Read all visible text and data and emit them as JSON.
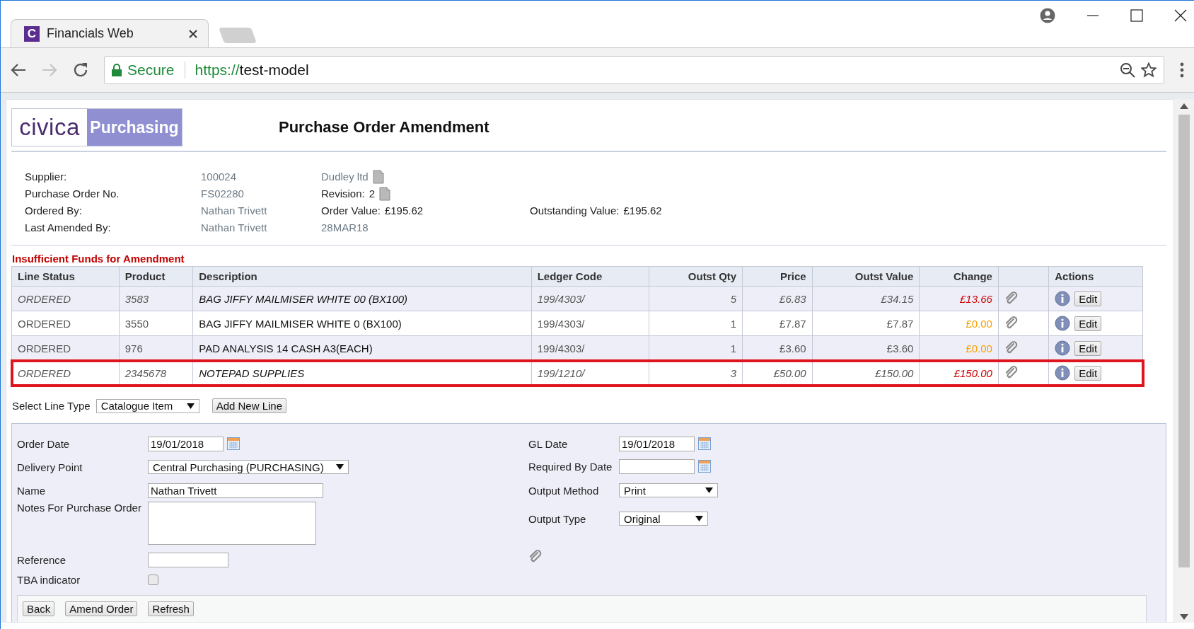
{
  "browser": {
    "tab_title": "Financials Web",
    "favicon_letter": "C",
    "secure_label": "Secure",
    "url_scheme": "https://",
    "url_host": "test-model"
  },
  "logo": {
    "brand": "civica",
    "product": "Purchasing"
  },
  "title": "Purchase Order Amendment",
  "summary": {
    "supplier_label": "Supplier:",
    "supplier_code": "100024",
    "supplier_name": "Dudley ltd",
    "po_label": "Purchase Order No.",
    "po_number": "FS02280",
    "revision_label": "Revision:",
    "revision": "2",
    "ordered_by_label": "Ordered By:",
    "ordered_by": "Nathan Trivett",
    "order_value_label": "Order Value:",
    "order_value": "£195.62",
    "outstanding_label": "Outstanding Value:",
    "outstanding_value": "£195.62",
    "last_amended_label": "Last Amended By:",
    "last_amended_by": "Nathan Trivett",
    "last_amended_date": "28MAR18"
  },
  "warning": "Insufficient Funds for Amendment",
  "table": {
    "columns": [
      "Line Status",
      "Product",
      "Description",
      "Ledger Code",
      "Outst Qty",
      "Price",
      "Outst Value",
      "Change",
      "Actions"
    ],
    "rows": [
      {
        "status": "ORDERED",
        "product": "3583",
        "description": "BAG JIFFY MAILMISER WHITE 00 (BX100)",
        "ledger_code": "199/4303/",
        "outst_qty": "5",
        "price": "£6.83",
        "outst_value": "£34.15",
        "change": "£13.66",
        "color": "#cc0000",
        "amended": true,
        "selected": false,
        "action": "Edit"
      },
      {
        "status": "ORDERED",
        "product": "3550",
        "description": "BAG JIFFY MAILMISER WHITE 0 (BX100)",
        "ledger_code": "199/4303/",
        "outst_qty": "1",
        "price": "£7.87",
        "outst_value": "£7.87",
        "change": "£0.00",
        "color": "#f5a000",
        "amended": false,
        "selected": false,
        "action": "Edit"
      },
      {
        "status": "ORDERED",
        "product": "976",
        "description": "PAD ANALYSIS 14 CASH A3(EACH)",
        "ledger_code": "199/4303/",
        "outst_qty": "1",
        "price": "£3.60",
        "outst_value": "£3.60",
        "change": "£0.00",
        "color": "#f5a000",
        "amended": false,
        "selected": false,
        "action": "Edit"
      },
      {
        "status": "ORDERED",
        "product": "2345678",
        "description": "NOTEPAD SUPPLIES",
        "ledger_code": "199/1210/",
        "outst_qty": "3",
        "price": "£50.00",
        "outst_value": "£150.00",
        "change": "£150.00",
        "color": "#cc0000",
        "amended": true,
        "selected": true,
        "action": "Edit"
      }
    ]
  },
  "line_type": {
    "label": "Select Line Type",
    "value": "Catalogue Item",
    "add_button": "Add New Line"
  },
  "form": {
    "left": [
      {
        "kind": "date",
        "label": "Order Date",
        "value": "19/01/2018"
      },
      {
        "kind": "select",
        "label": "Delivery Point",
        "value": "Central Purchasing (PURCHASING)"
      },
      {
        "kind": "text",
        "label": "Name",
        "value": "Nathan Trivett"
      },
      {
        "kind": "textarea",
        "label": "Notes For Purchase Order"
      },
      {
        "kind": "text",
        "label": "Reference"
      },
      {
        "kind": "checkbox",
        "label": "TBA indicator",
        "checked": false
      }
    ],
    "right": [
      {
        "kind": "date",
        "label": "GL Date",
        "value": "19/01/2018"
      },
      {
        "kind": "date",
        "label": "Required By Date"
      },
      {
        "kind": "select",
        "label": "Output Method",
        "value": "Print"
      },
      {
        "kind": "select",
        "label": "Output Type",
        "value": "Original"
      }
    ],
    "buttons": [
      "Back",
      "Amend Order",
      "Refresh"
    ]
  }
}
